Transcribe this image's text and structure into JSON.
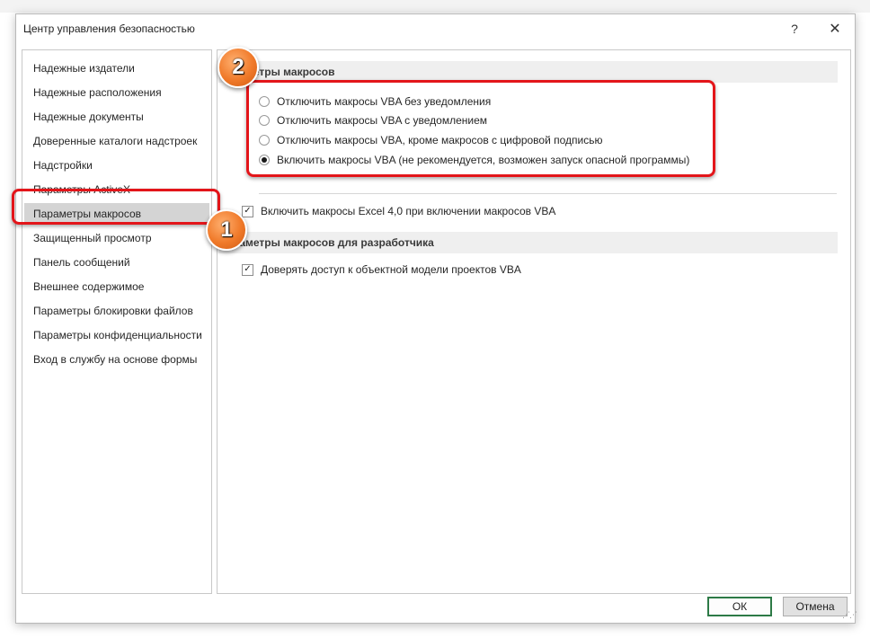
{
  "dialog": {
    "title": "Центр управления безопасностью",
    "help_label": "?",
    "close_label": "✕"
  },
  "sidebar": {
    "items": [
      {
        "label": "Надежные издатели"
      },
      {
        "label": "Надежные расположения"
      },
      {
        "label": "Надежные документы"
      },
      {
        "label": "Доверенные каталоги надстроек"
      },
      {
        "label": "Надстройки"
      },
      {
        "label": "Параметры ActiveX"
      },
      {
        "label": "Параметры макросов",
        "selected": true
      },
      {
        "label": "Защищенный просмотр"
      },
      {
        "label": "Панель сообщений"
      },
      {
        "label": "Внешнее содержимое"
      },
      {
        "label": "Параметры блокировки файлов"
      },
      {
        "label": "Параметры конфиденциальности"
      },
      {
        "label": "Вход в службу на основе формы"
      }
    ]
  },
  "macro_settings": {
    "header": "раметры макросов",
    "options": [
      {
        "label": "Отключить макросы VBA без уведомления",
        "checked": false
      },
      {
        "label": "Отключить макросы VBA с уведомлением",
        "checked": false
      },
      {
        "label": "Отключить макросы VBA, кроме макросов с цифровой подписью",
        "checked": false
      },
      {
        "label": "Включить макросы VBA (не рекомендуется, возможен запуск опасной программы)",
        "checked": true
      }
    ],
    "excel4_label": "Включить макросы Excel 4,0 при включении макросов VBA",
    "excel4_checked": true
  },
  "developer_settings": {
    "header": "раметры макросов для разработчика",
    "trust_vba_label": "Доверять доступ к объектной модели проектов VBA",
    "trust_vba_checked": true
  },
  "buttons": {
    "ok_label": "ОК",
    "cancel_label": "Отмена"
  },
  "annotations": {
    "marker1": "1",
    "marker2": "2",
    "color": "#e3151a"
  },
  "check_glyph": "✓",
  "grip_glyph": "⋰⋰"
}
